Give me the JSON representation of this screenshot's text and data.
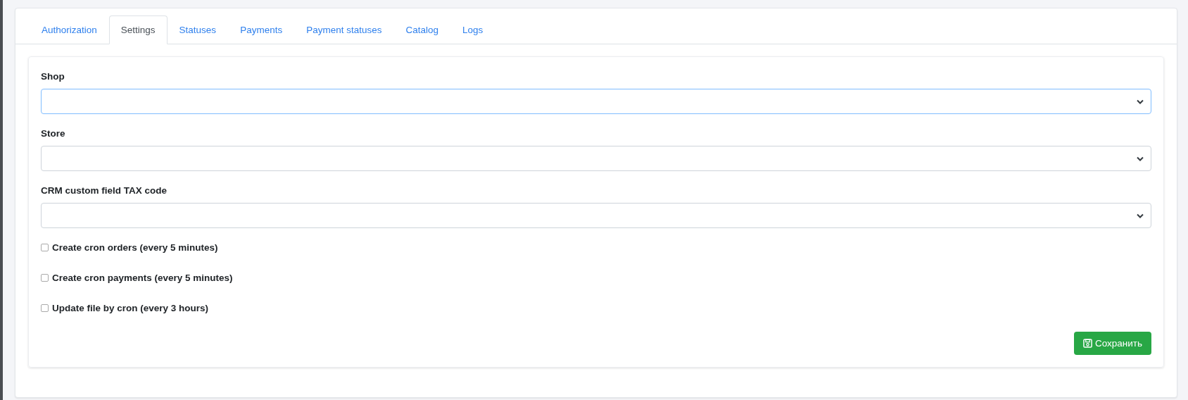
{
  "tabs": [
    {
      "label": "Authorization",
      "selected": false
    },
    {
      "label": "Settings",
      "selected": true
    },
    {
      "label": "Statuses",
      "selected": false
    },
    {
      "label": "Payments",
      "selected": false
    },
    {
      "label": "Payment statuses",
      "selected": false
    },
    {
      "label": "Catalog",
      "selected": false
    },
    {
      "label": "Logs",
      "selected": false
    }
  ],
  "fields": [
    {
      "label": "Shop",
      "focused": true
    },
    {
      "label": "Store",
      "focused": false
    },
    {
      "label": "CRM custom field TAX code",
      "focused": false
    }
  ],
  "checkboxes": [
    {
      "label": "Create cron orders (every 5 minutes)",
      "checked": false
    },
    {
      "label": "Create cron payments (every 5 minutes)",
      "checked": false
    },
    {
      "label": "Update file by cron (every 3 hours)",
      "checked": false
    }
  ],
  "save_button": {
    "label": "Сохранить"
  }
}
